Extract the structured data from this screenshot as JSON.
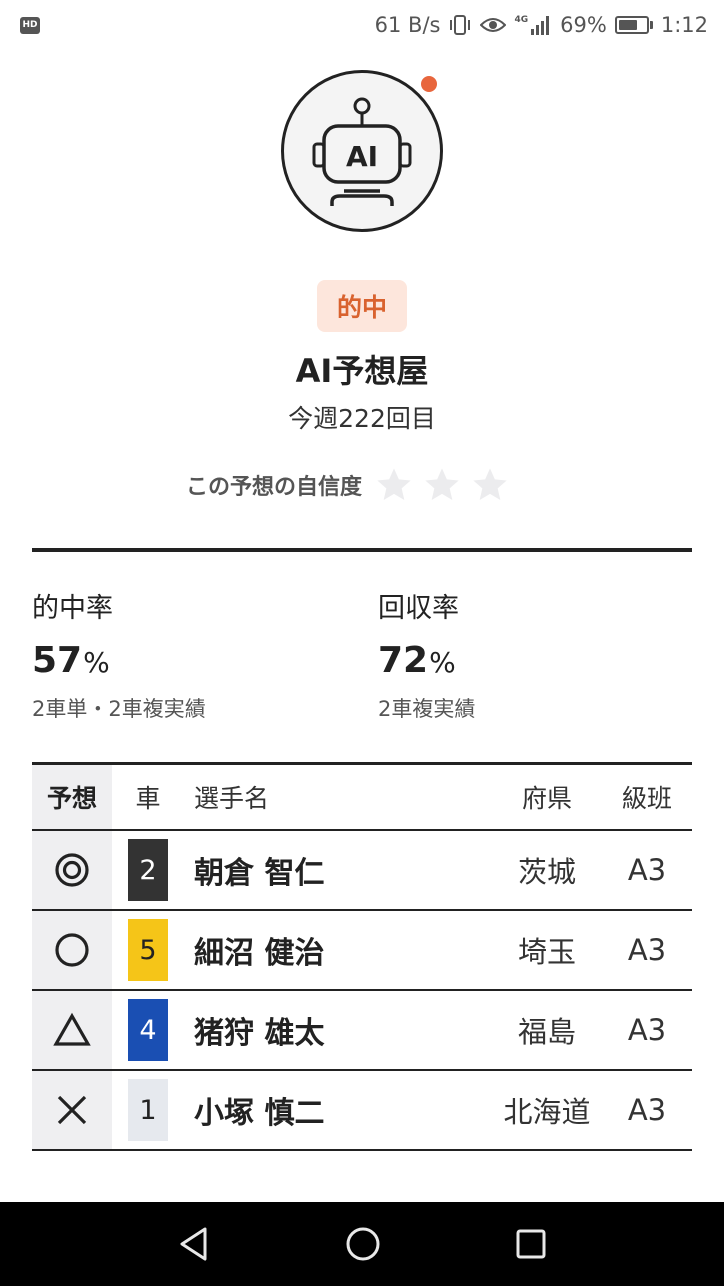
{
  "status_bar": {
    "hd_label": "HD",
    "net_speed": "61 B/s",
    "network_label": "4G",
    "battery_pct": "69%",
    "battery_level": 0.69,
    "time": "1:12"
  },
  "header": {
    "avatar_icon": "robot-ai-icon",
    "avatar_text": "AI",
    "badge": "的中",
    "title": "AI予想屋",
    "subtitle": "今週222回目",
    "confidence_label": "この予想の自信度",
    "confidence_stars_filled": 0,
    "confidence_stars_total": 3
  },
  "stats": {
    "hit_rate": {
      "label": "的中率",
      "value": "57",
      "unit": "%",
      "note": "2車単・2車複実績"
    },
    "return_rate": {
      "label": "回収率",
      "value": "72",
      "unit": "%",
      "note": "2車複実績"
    }
  },
  "table": {
    "headers": {
      "mark": "予想",
      "car": "車",
      "name": "選手名",
      "pref": "府県",
      "class": "級班"
    },
    "rows": [
      {
        "mark": "double-circle-icon",
        "car": "2",
        "car_bg": "#333333",
        "car_fg": "#ffffff",
        "name": "朝倉 智仁",
        "pref": "茨城",
        "class": "A3"
      },
      {
        "mark": "circle-icon",
        "car": "5",
        "car_bg": "#f5c518",
        "car_fg": "#222222",
        "name": "細沼 健治",
        "pref": "埼玉",
        "class": "A3"
      },
      {
        "mark": "triangle-icon",
        "car": "4",
        "car_bg": "#1a4fb3",
        "car_fg": "#ffffff",
        "name": "猪狩 雄太",
        "pref": "福島",
        "class": "A3"
      },
      {
        "mark": "cross-icon",
        "car": "1",
        "car_bg": "#e6e9ee",
        "car_fg": "#222222",
        "name": "小塚 慎二",
        "pref": "北海道",
        "class": "A3"
      }
    ]
  },
  "navbar": {
    "back_icon": "back-triangle-icon",
    "home_icon": "home-circle-icon",
    "recents_icon": "recents-square-icon"
  },
  "colors": {
    "accent": "#e8663d",
    "badge_bg": "#fde6dc",
    "badge_fg": "#d9622e"
  }
}
